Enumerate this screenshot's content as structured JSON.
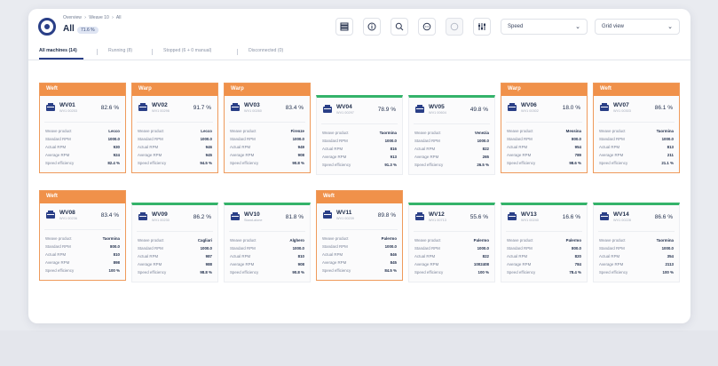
{
  "breadcrumb": [
    "Overview",
    "›",
    "Weave 10",
    "›",
    "All"
  ],
  "title": "All",
  "count_badge": "71.6 %",
  "toolbar": {
    "icons": [
      "list-view-icon",
      "info-icon",
      "search-icon",
      "chat-icon",
      "chat-disabled-icon",
      "filter-sliders-icon"
    ],
    "metric_select": "Speed",
    "view_select": "Grid view"
  },
  "tabs": [
    {
      "label": "All machines (14)",
      "active": true
    },
    {
      "label": "Running (8)",
      "active": false
    },
    {
      "label": "Stopped (6 + 0 manual)",
      "active": false
    },
    {
      "label": "Disconnected (0)",
      "active": false
    }
  ],
  "stat_labels": [
    "Weave product",
    "Standard RPM",
    "Actual RPM",
    "Average RPM",
    "Speed efficiency"
  ],
  "machines": [
    {
      "name": "WV01",
      "serial": "WV1 00253",
      "pct": "82.6 %",
      "status": "Weft",
      "values": [
        "Lecco",
        "1000.0",
        "930",
        "924",
        "82.4 %"
      ]
    },
    {
      "name": "WV02",
      "serial": "WV1 00296",
      "pct": "91.7 %",
      "status": "Warp",
      "values": [
        "Lecco",
        "1000.0",
        "946",
        "945",
        "94.5 %"
      ]
    },
    {
      "name": "WV03",
      "serial": "WV1 00260",
      "pct": "83.4 %",
      "status": "Warp",
      "values": [
        "Firenze",
        "1000.0",
        "949",
        "908",
        "90.8 %"
      ]
    },
    {
      "name": "WV04",
      "serial": "WV1 00297",
      "pct": "78.9 %",
      "status": "",
      "values": [
        "Taormina",
        "1000.0",
        "816",
        "913",
        "91.3 %"
      ]
    },
    {
      "name": "WV05",
      "serial": "WV1 00604",
      "pct": "49.8 %",
      "status": "",
      "values": [
        "Venezia",
        "1000.0",
        "822",
        "265",
        "26.5 %"
      ]
    },
    {
      "name": "WV06",
      "serial": "WV1 00302",
      "pct": "18.0 %",
      "status": "Warp",
      "values": [
        "Messina",
        "800.0",
        "954",
        "789",
        "98.6 %"
      ]
    },
    {
      "name": "WV07",
      "serial": "WV1 00303",
      "pct": "86.1 %",
      "status": "Weft",
      "values": [
        "Taormina",
        "1000.0",
        "813",
        "211",
        "21.1 %"
      ]
    },
    {
      "name": "WV08",
      "serial": "WV1 00236",
      "pct": "83.4 %",
      "status": "Weft",
      "values": [
        "Taormina",
        "800.0",
        "810",
        "898",
        "100 %"
      ]
    },
    {
      "name": "WV09",
      "serial": "WV1 00230",
      "pct": "86.2 %",
      "status": "",
      "values": [
        "Cagliari",
        "1000.0",
        "987",
        "988",
        "98.8 %"
      ]
    },
    {
      "name": "WV10",
      "serial": "Stand-alone",
      "pct": "81.8 %",
      "status": "",
      "values": [
        "Alghero",
        "1000.0",
        "810",
        "908",
        "90.8 %"
      ]
    },
    {
      "name": "WV11",
      "serial": "WV1 00239",
      "pct": "89.8 %",
      "status": "Weft",
      "values": [
        "Palermo",
        "1000.0",
        "846",
        "845",
        "84.5 %"
      ]
    },
    {
      "name": "WV12",
      "serial": "WV1 00713",
      "pct": "55.6 %",
      "status": "",
      "values": [
        "Palermo",
        "1000.0",
        "822",
        "1002408",
        "100 %"
      ]
    },
    {
      "name": "WV13",
      "serial": "WV1 00240",
      "pct": "16.6 %",
      "status": "",
      "values": [
        "Palermo",
        "800.0",
        "820",
        "784",
        "78.4 %"
      ]
    },
    {
      "name": "WV14",
      "serial": "WV1 00228",
      "pct": "86.6 %",
      "status": "",
      "values": [
        "Taormina",
        "1000.0",
        "354",
        "2113",
        "100 %"
      ]
    }
  ],
  "colors": {
    "accent": "#2a3f87",
    "warning": "#f0914a",
    "ok": "#34b36a"
  }
}
